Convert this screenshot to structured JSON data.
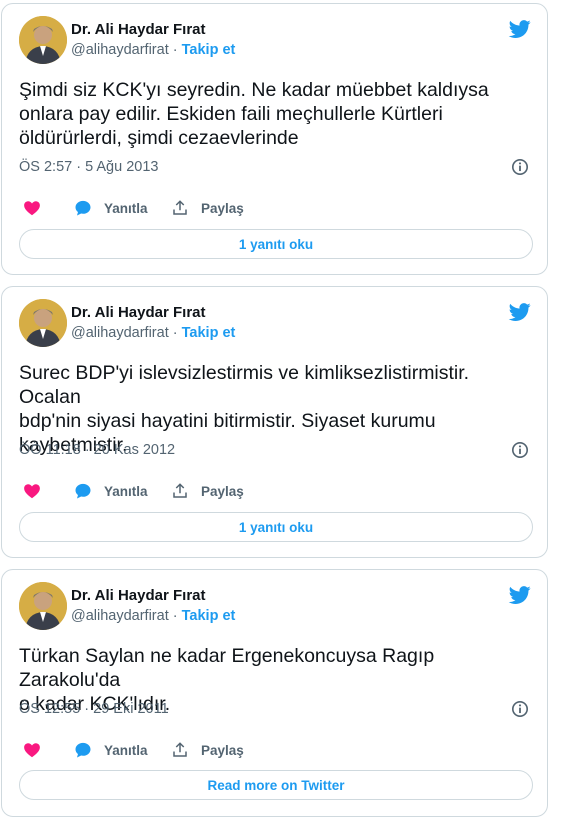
{
  "colors": {
    "accent": "#1d9bf0",
    "heart": "#f91880",
    "muted": "#536471",
    "border": "#cfd9de"
  },
  "tweets": [
    {
      "name": "Dr. Ali Haydar Fırat",
      "handle": "@alihaydarfirat",
      "separator": "·",
      "follow": "Takip et",
      "lines": [
        "Şimdi siz KCK'yı seyredin. Ne kadar müebbet kaldıysa",
        "onlara pay edilir. Eskiden faili meçhullerle Kürtleri",
        "öldürürlerdi, şimdi cezaevlerinde"
      ],
      "timestamp": "ÖS 2:57 · 5 Ağu 2013",
      "reply_label": "Yanıtla",
      "share_label": "Paylaş",
      "footer_button": "1 yanıtı oku"
    },
    {
      "name": "Dr. Ali Haydar Fırat",
      "handle": "@alihaydarfirat",
      "separator": "·",
      "follow": "Takip et",
      "lines": [
        "Surec BDP'yi islevsizlestirmis ve kimliksezlistirmistir. Ocalan",
        "bdp'nin siyasi hayatini bitirmistir. Siyaset kurumu",
        "kaybetmistir."
      ],
      "timestamp": "ÖÖ 11:18 · 20 Kas 2012",
      "reply_label": "Yanıtla",
      "share_label": "Paylaş",
      "footer_button": "1 yanıtı oku"
    },
    {
      "name": "Dr. Ali Haydar Fırat",
      "handle": "@alihaydarfirat",
      "separator": "·",
      "follow": "Takip et",
      "lines": [
        "Türkan Saylan ne kadar Ergenekoncuysa Ragıp Zarakolu'da",
        "o kadar KCK'lıdır."
      ],
      "timestamp": "ÖS 12:55 · 29 Eki 2011",
      "reply_label": "Yanıtla",
      "share_label": "Paylaş",
      "footer_button": "Read more on Twitter"
    }
  ]
}
